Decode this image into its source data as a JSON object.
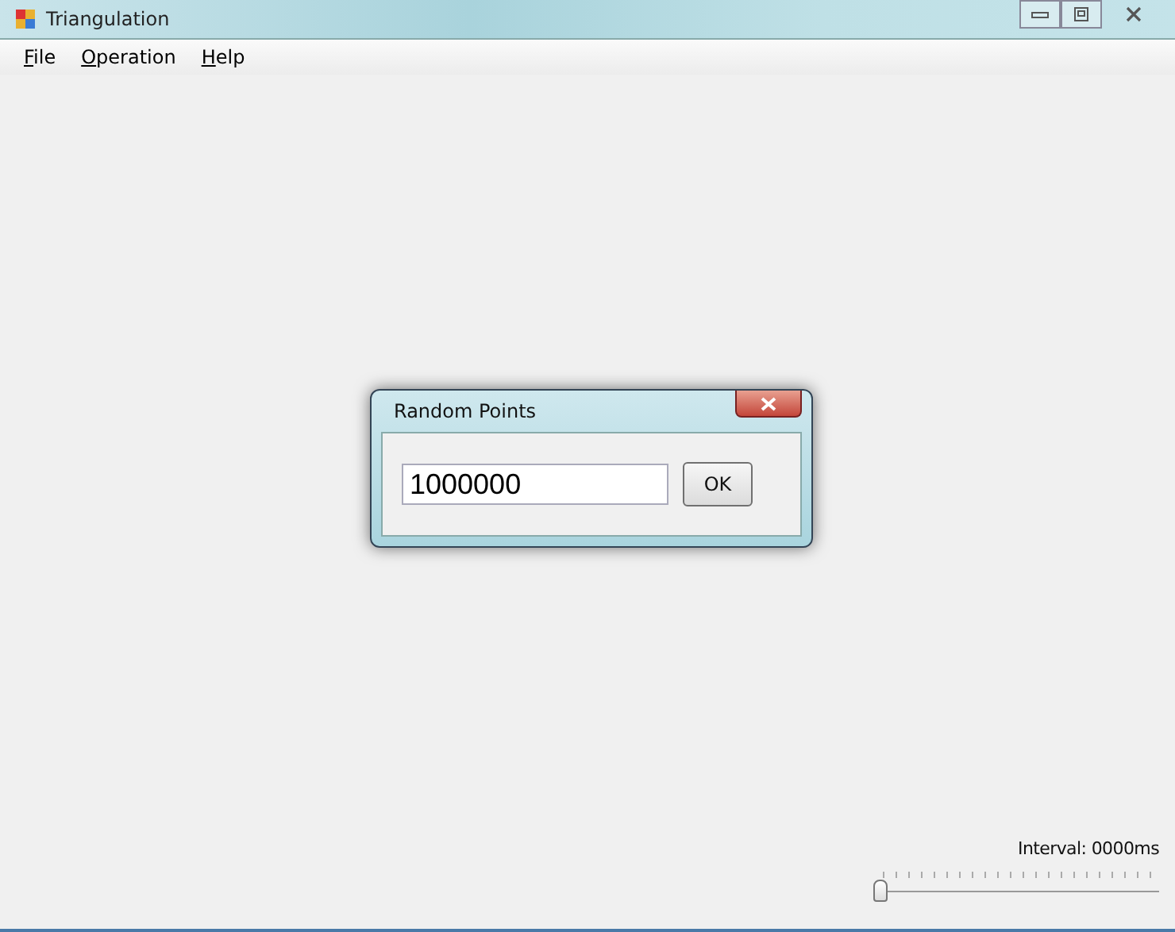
{
  "window": {
    "title": "Triangulation"
  },
  "menu": [
    {
      "label": "File",
      "access_key_underlined": true
    },
    {
      "label": "Operation",
      "access_key_underlined": true
    },
    {
      "label": "Help",
      "access_key_underlined": true
    }
  ],
  "dialog": {
    "title": "Random Points",
    "input": {
      "value": "1000000"
    },
    "button": "OK"
  },
  "interval": {
    "label": "Interval: 0000ms",
    "level": 0
  }
}
